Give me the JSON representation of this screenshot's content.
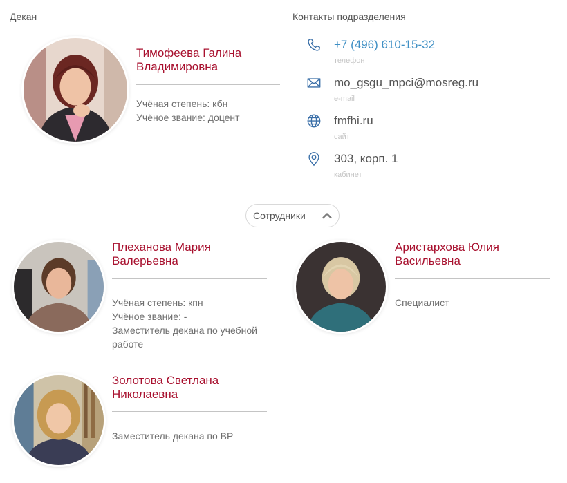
{
  "dean": {
    "section_label": "Декан",
    "name": "Тимофеева Галина Владимировна",
    "details": [
      "Учёная степень: кбн",
      "Учёное звание: доцент"
    ]
  },
  "contacts": {
    "section_label": "Контакты подразделения",
    "items": [
      {
        "icon": "phone-icon",
        "value": "+7 (496) 610-15-32",
        "caption": "телефон"
      },
      {
        "icon": "envelope-icon",
        "value": "mo_gsgu_mpci@mosreg.ru",
        "caption": "e-mail"
      },
      {
        "icon": "globe-icon",
        "value": "fmfhi.ru",
        "caption": "сайт"
      },
      {
        "icon": "map-pin-icon",
        "value": "303, корп. 1",
        "caption": "кабинет"
      }
    ]
  },
  "staff_toggle": {
    "label": "Сотрудники",
    "icon": "chevron-up-icon",
    "expanded": true
  },
  "staff": [
    {
      "name": "Плеханова Мария Валерьевна",
      "details": [
        "Учёная степень: кпн",
        "Учёное звание: -",
        "Заместитель декана по учебной",
        "работе"
      ]
    },
    {
      "name": "Аристархова Юлия Васильевна",
      "details": [
        "Специалист"
      ]
    },
    {
      "name": "Золотова Светлана Николаевна",
      "details": [
        "Заместитель декана по ВР"
      ]
    }
  ],
  "colors": {
    "name_accent": "#a8102e",
    "link_accent": "#3e8fc4",
    "icon_accent": "#3a6fa8"
  }
}
